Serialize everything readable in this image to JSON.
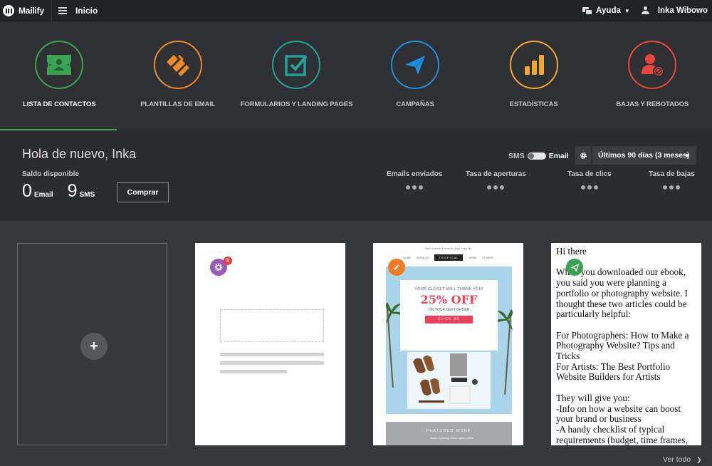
{
  "topbar": {
    "brand": "Mailify",
    "home": "Inicio",
    "help": "Ayuda",
    "user_name": "Inka Wibowo"
  },
  "modules": [
    {
      "label": "LISTA DE CONTACTOS",
      "icon": "contacts-card-icon",
      "color": "#3aa353",
      "active": true
    },
    {
      "label": "PLANTILLAS DE EMAIL",
      "icon": "templates-icon",
      "color": "#f08a24",
      "active": false
    },
    {
      "label": "FORMULARIOS Y LANDING PAGES",
      "icon": "form-check-icon",
      "color": "#1fa39a",
      "active": false
    },
    {
      "label": "CAMPAÑAS",
      "icon": "paper-plane-icon",
      "color": "#1b8fe0",
      "active": false
    },
    {
      "label": "ESTADÍSTICAS",
      "icon": "bar-stats-icon",
      "color": "#f0a830",
      "active": false
    },
    {
      "label": "BAJAS Y REBOTADOS",
      "icon": "user-blocked-icon",
      "color": "#e8453c",
      "active": false
    }
  ],
  "overview": {
    "greeting": "Hola de nuevo, Inka",
    "balance_label": "Saldo disponible",
    "email_count": "0",
    "email_unit": "Email",
    "sms_count": "9",
    "sms_unit": "SMS",
    "buy_button": "Comprar",
    "toggle_sms": "SMS",
    "toggle_email": "Email",
    "range": "Últimos 90 días (3 meses)",
    "stats": [
      {
        "label": "Emails enviados",
        "value": "•••"
      },
      {
        "label": "Tasa de aperturas",
        "value": "•••"
      },
      {
        "label": "Tasa de clics",
        "value": "•••"
      },
      {
        "label": "Tasa de bajas",
        "value": "•••"
      }
    ]
  },
  "cards": {
    "new_symbol": "+",
    "promo": {
      "top_note": "Para visualizar el email en línea, haga clic",
      "nav": [
        "HOME",
        "SERVICES",
        "TROPICAL",
        "WORK",
        "STORIES"
      ],
      "line1": "YOUR CLOSET WILL THANK YOU!",
      "headline": "25% OFF",
      "line3": "ON YOUR NEXT ORDER",
      "cta": "CLICK ME",
      "featured": "FEATURED WORK",
      "featured_sub": "Haque adipiscing cursus sapien portitor"
    },
    "letter": {
      "text": "Hi there\n\nWhen you downloaded our ebook, you said you were planning a portfolio or photography website. I thought these two articles could be particularly helpful:\n\nFor Photographers: How to Make a Photography Website? Tips and Tricks\nFor Artists: The Best Portfolio Website Builders for Artists\n\nThey will give you:\n-Info on how a website can boost your brand or business\n-A handy checklist of typical requirements (budget, time frames,"
    },
    "view_all": "Ver todo"
  },
  "colors": {
    "accent_green": "#3aa353",
    "badge_purple": "#9b59b6",
    "badge_orange": "#f07a1e",
    "badge_green": "#3aa353",
    "pause_red": "#e53b3b"
  }
}
